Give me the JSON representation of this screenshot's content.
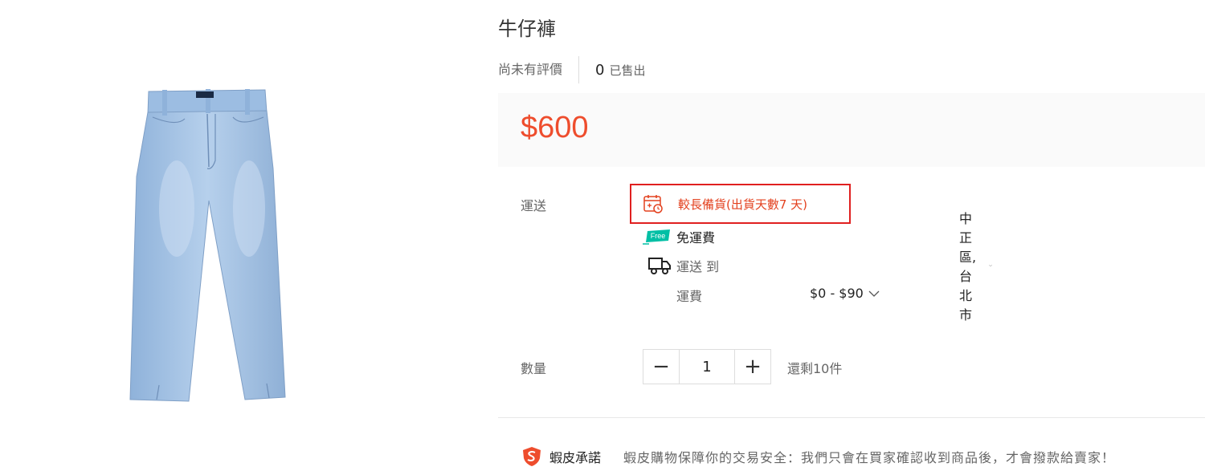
{
  "product": {
    "title": "牛仔褲",
    "rating_text": "尚未有評價",
    "sold_count": "0",
    "sold_label": "已售出",
    "price": "$600",
    "image_icon": "jeans-image"
  },
  "shipping": {
    "label": "運送",
    "notice": "較長備貨(出貨天數7 天)",
    "notice_icon": "calendar-clock-icon",
    "free_badge": "Free",
    "free_text": "免運費",
    "ship_to_label": "運送 到",
    "ship_to_value": "中正區, 台北市",
    "fee_label": "運費",
    "fee_value": "$0 - $90"
  },
  "quantity": {
    "label": "數量",
    "minus": "−",
    "value": "1",
    "plus": "+",
    "stock": "還剩10件"
  },
  "guarantee": {
    "title": "蝦皮承諾",
    "text": "蝦皮購物保障你的交易安全：我們只會在買家確認收到商品後，才會撥款給賣家！"
  },
  "colors": {
    "accent": "#ee4d2d",
    "notice_border": "#e02020",
    "free_badge": "#00bfa5",
    "denim": "#a8c6e6"
  }
}
